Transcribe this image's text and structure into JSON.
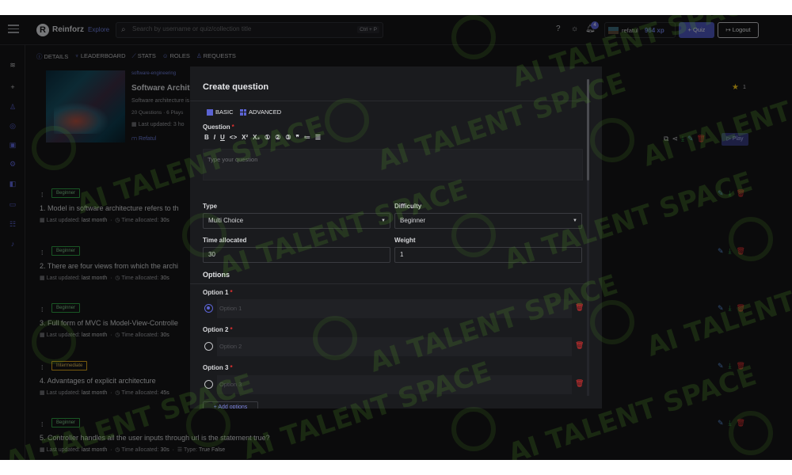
{
  "header": {
    "brand": "Reinforz",
    "explore": "Explore",
    "search_placeholder": "Search by username or quiz/collection title",
    "search_shortcut": "Ctrl + P",
    "notification_count": "4",
    "username": "refatul",
    "xp": "964 xp",
    "quiz_button": "+ Quiz",
    "logout_button": "Logout"
  },
  "tabs": [
    {
      "label": "DETAILS",
      "icon": "info-icon"
    },
    {
      "label": "LEADERBOARD",
      "icon": "trophy-icon"
    },
    {
      "label": "STATS",
      "icon": "stats-icon"
    },
    {
      "label": "ROLES",
      "icon": "users-icon"
    },
    {
      "label": "REQUESTS",
      "icon": "user-plus-icon"
    }
  ],
  "quiz": {
    "category": "software-engineering",
    "title": "Software Archite",
    "description": "Software architecture is",
    "stats": "20 Questions · 6 Plays",
    "last_updated": "Last updated:  3 ho",
    "author": "Refatul",
    "star_count": "1",
    "play_button": "▷ Play"
  },
  "questions": [
    {
      "level": "Beginner",
      "text": "1. Model in software architecture refers to th",
      "updated_label": "Last updated:",
      "updated": "last month",
      "time_label": "Time allocated:",
      "time": "30s",
      "type_label": "",
      "type": ""
    },
    {
      "level": "Beginner",
      "text": "2. There are four views from which the archi",
      "updated_label": "Last updated:",
      "updated": "last month",
      "time_label": "Time allocated:",
      "time": "30s",
      "type_label": "",
      "type": ""
    },
    {
      "level": "Beginner",
      "text": "3. Full form of MVC is Model-View-Controlle",
      "updated_label": "Last updated:",
      "updated": "last month",
      "time_label": "Time allocated:",
      "time": "30s",
      "type_label": "",
      "type": ""
    },
    {
      "level": "Intermediate",
      "text": "4. Advantages of explicit architecture",
      "updated_label": "Last updated:",
      "updated": "last month",
      "time_label": "Time allocated:",
      "time": "45s",
      "type_label": "",
      "type": ""
    },
    {
      "level": "Beginner",
      "text": "5. Controller handles all the user inputs through url is the statement true?",
      "updated_label": "Last updated:",
      "updated": "last month",
      "time_label": "Time allocated:",
      "time": "30s",
      "type_label": "Type:",
      "type": "True False"
    }
  ],
  "modal": {
    "title": "Create question",
    "tab_basic": "BASIC",
    "tab_advanced": "ADVANCED",
    "question_label": "Question",
    "required_mark": "*",
    "toolbar": [
      "B",
      "I",
      "U",
      "<>",
      "X²",
      "X₂",
      "①",
      "②",
      "③",
      "❞",
      "≔",
      "☰"
    ],
    "question_placeholder": "Type your question",
    "type_label": "Type",
    "type_value": "Multi Choice",
    "difficulty_label": "Difficulty",
    "difficulty_value": "Beginner",
    "time_label": "Time allocated",
    "time_value": "30",
    "weight_label": "Weight",
    "weight_value": "1",
    "options_heading": "Options",
    "options": [
      {
        "label": "Option 1",
        "placeholder": "Option 1",
        "selected": true
      },
      {
        "label": "Option 2",
        "placeholder": "Option 2",
        "selected": false
      },
      {
        "label": "Option 3",
        "placeholder": "Option 3",
        "selected": false
      }
    ],
    "add_options": "+ Add options"
  },
  "watermark": "AI TALENT SPACE",
  "colors": {
    "accent": "#5b63d3",
    "danger": "#e03131",
    "success": "#2f9e44",
    "warning": "#d9a21b"
  }
}
